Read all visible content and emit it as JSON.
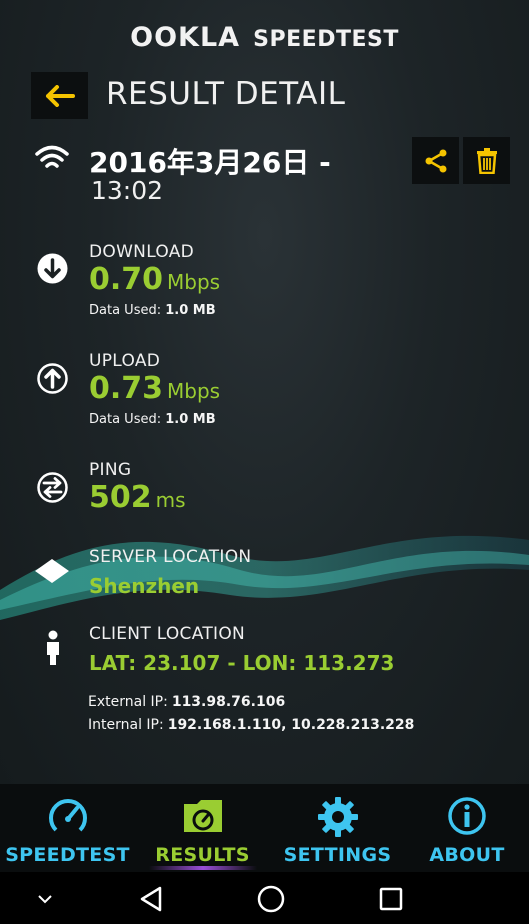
{
  "brand": {
    "ookla": "OOKLA",
    "speedtest": "SPEEDTEST"
  },
  "header": {
    "title": "RESULT DETAIL"
  },
  "result": {
    "date": "2016年3月26日 -",
    "time": "13:02"
  },
  "download": {
    "label": "DOWNLOAD",
    "value": "0.70",
    "unit": "Mbps",
    "data_used_label": "Data Used:",
    "data_used_value": "1.0 MB"
  },
  "upload": {
    "label": "UPLOAD",
    "value": "0.73",
    "unit": "Mbps",
    "data_used_label": "Data Used:",
    "data_used_value": "1.0 MB"
  },
  "ping": {
    "label": "PING",
    "value": "502",
    "unit": "ms"
  },
  "server": {
    "label": "SERVER LOCATION",
    "value": "Shenzhen"
  },
  "client": {
    "label": "CLIENT LOCATION",
    "value": "LAT: 23.107 - LON: 113.273",
    "external_ip_label": "External IP:",
    "external_ip": "113.98.76.106",
    "internal_ip_label": "Internal IP:",
    "internal_ip": "192.168.1.110, 10.228.213.228"
  },
  "tabs": [
    {
      "label": "SPEEDTEST",
      "icon": "speedometer-icon"
    },
    {
      "label": "RESULTS",
      "icon": "folder-gauge-icon",
      "active": true
    },
    {
      "label": "SETTINGS",
      "icon": "gear-icon"
    },
    {
      "label": "ABOUT",
      "icon": "info-icon"
    }
  ],
  "colors": {
    "accent_green": "#9acd32",
    "accent_blue": "#3ec5f0",
    "accent_yellow": "#f5c400"
  }
}
